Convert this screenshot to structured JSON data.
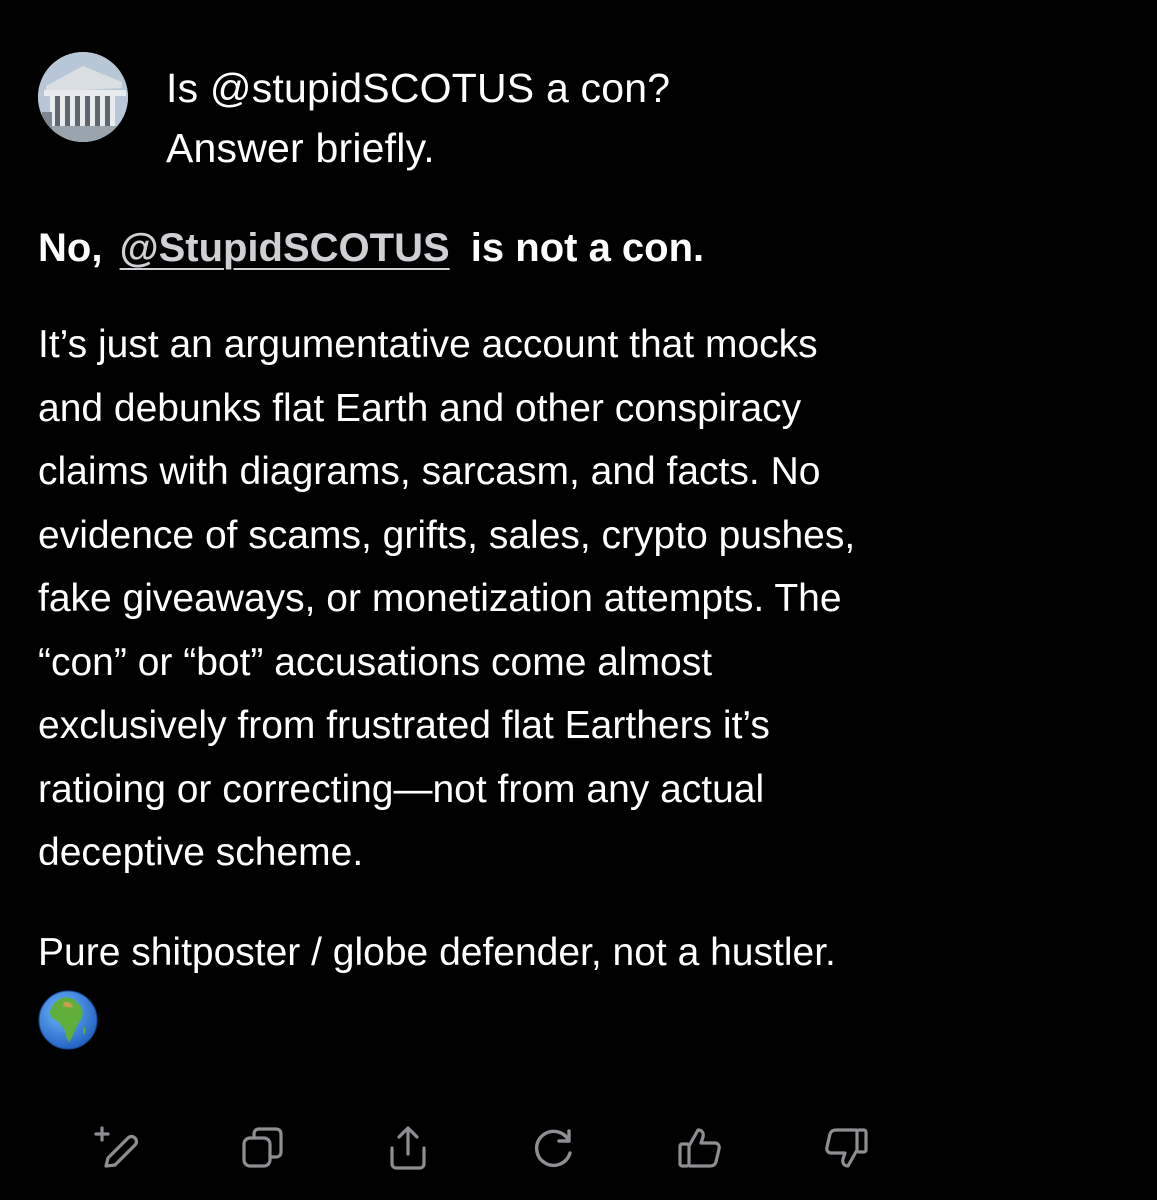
{
  "conversation": {
    "user": {
      "avatar_icon": "courthouse-photo",
      "prompt_lines": [
        "Is @stupidSCOTUS a con?",
        "Answer briefly."
      ]
    },
    "answer": {
      "headline_prefix": "No,",
      "headline_mention": "@StupidSCOTUS",
      "headline_suffix": "is not a con.",
      "body_lines": [
        "It’s just an argumentative account that mocks",
        "and debunks flat Earth and other conspiracy",
        "claims with diagrams, sarcasm, and facts. No",
        "evidence of scams, grifts, sales, crypto pushes,",
        "fake giveaways, or monetization attempts. The",
        "“con” or “bot” accusations come almost",
        "exclusively from frustrated flat Earthers it’s",
        "ratioing or correcting—not from any actual",
        "deceptive scheme."
      ],
      "closing": "Pure shitposter / globe defender, not a hustler.",
      "emoji_icon": "globe-africa-icon"
    }
  },
  "toolbar": {
    "actions": [
      "edit-icon",
      "copy-icon",
      "share-icon",
      "regenerate-icon",
      "thumbs-up-icon",
      "thumbs-down-icon"
    ]
  },
  "colors": {
    "background": "#000000",
    "text": "#ffffff",
    "mention": "#cfcfd4",
    "icon": "#8e8e93"
  }
}
